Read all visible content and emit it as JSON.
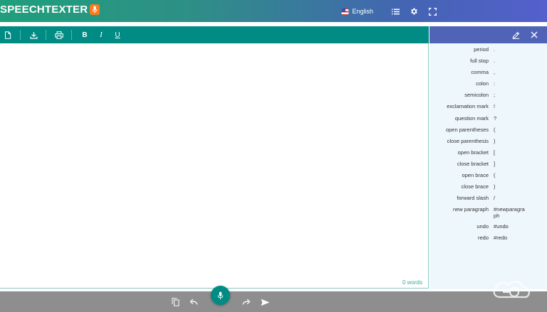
{
  "header": {
    "logo_text": "SPEECHTEXTER",
    "language_label": "English",
    "icons": [
      "mic-icon",
      "flag-icon",
      "list-icon",
      "gear-icon",
      "fullscreen-icon"
    ]
  },
  "toolbar": {
    "icons": [
      "new-document-icon",
      "download-icon",
      "print-icon",
      "bold-icon",
      "italic-icon",
      "underline-icon"
    ],
    "bold_label": "B",
    "italic_label": "I",
    "underline_label": "U"
  },
  "editor": {
    "word_count": "0 words"
  },
  "panel": {
    "icons": [
      "edit-icon",
      "close-icon"
    ],
    "commands": [
      {
        "phrase": "period",
        "output": "."
      },
      {
        "phrase": "full stop",
        "output": "."
      },
      {
        "phrase": "comma",
        "output": ","
      },
      {
        "phrase": "colon",
        "output": ":"
      },
      {
        "phrase": "semicolon",
        "output": ";"
      },
      {
        "phrase": "exclamation mark",
        "output": "!"
      },
      {
        "phrase": "question mark",
        "output": "?"
      },
      {
        "phrase": "open parentheses",
        "output": "("
      },
      {
        "phrase": "close parenthesis",
        "output": ")"
      },
      {
        "phrase": "open bracket",
        "output": "["
      },
      {
        "phrase": "close bracket",
        "output": "]"
      },
      {
        "phrase": "open brace",
        "output": "("
      },
      {
        "phrase": "close brace",
        "output": ")"
      },
      {
        "phrase": "forward slash",
        "output": "/"
      },
      {
        "phrase": "new paragraph",
        "output": "#newparagraph"
      },
      {
        "phrase": "undo",
        "output": "#undo"
      },
      {
        "phrase": "redo",
        "output": "#redo"
      }
    ]
  },
  "bottom_bar": {
    "icons": [
      "copy-icon",
      "undo-icon",
      "microphone-icon",
      "redo-icon",
      "send-icon"
    ]
  },
  "colors": {
    "teal": "#008b84",
    "panel_blue": "#4f64b6",
    "bottom_gray": "#8e8e8e",
    "accent_orange": "#ff7a1a"
  }
}
